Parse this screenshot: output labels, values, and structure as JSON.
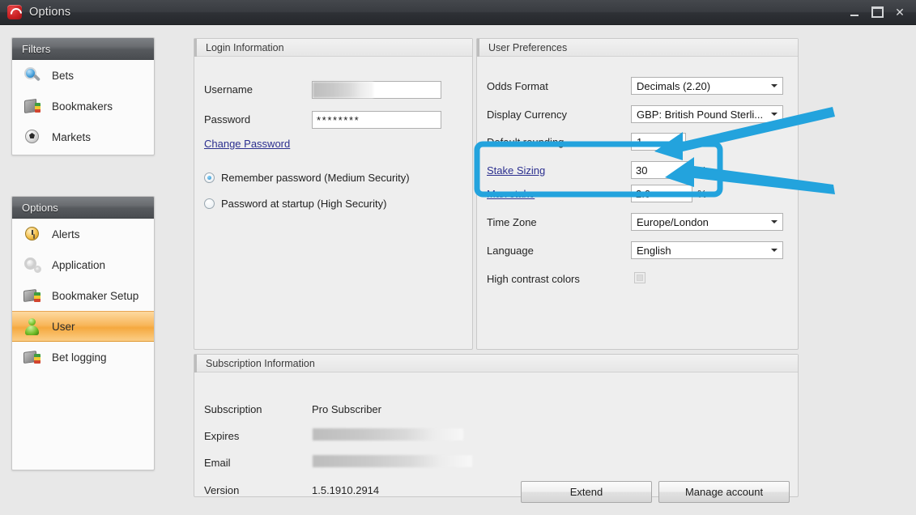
{
  "window": {
    "title": "Options",
    "app_icon": "app-logo-icon",
    "controls": [
      {
        "name": "minimize",
        "glyph": ""
      },
      {
        "name": "maximize",
        "glyph": ""
      },
      {
        "name": "close",
        "glyph": "✕"
      }
    ]
  },
  "sidebar": {
    "groups": [
      {
        "title": "Filters",
        "items": [
          {
            "label": "Bets",
            "icon": "magnifier-icon",
            "selected": false
          },
          {
            "label": "Bookmakers",
            "icon": "book-icon",
            "selected": false
          },
          {
            "label": "Markets",
            "icon": "football-icon",
            "selected": false
          }
        ]
      },
      {
        "title": "Options",
        "items": [
          {
            "label": "Alerts",
            "icon": "alarm-clock-icon",
            "selected": false
          },
          {
            "label": "Application",
            "icon": "gears-icon",
            "selected": false
          },
          {
            "label": "Bookmaker Setup",
            "icon": "bookmaker-setup-icon",
            "selected": false
          },
          {
            "label": "User",
            "icon": "user-icon",
            "selected": true
          },
          {
            "label": "Bet logging",
            "icon": "bet-logging-icon",
            "selected": false
          }
        ]
      }
    ]
  },
  "login": {
    "title": "Login Information",
    "username_label": "Username",
    "username_value": "",
    "password_label": "Password",
    "password_value": "********",
    "change_password_link": "Change Password",
    "radios": [
      {
        "label": "Remember password (Medium Security)",
        "selected": true
      },
      {
        "label": "Password at startup (High Security)",
        "selected": false
      }
    ]
  },
  "preferences": {
    "title": "User Preferences",
    "rows": [
      {
        "label": "Odds Format",
        "value": "Decimals (2.20)",
        "control": "combo",
        "unit": ""
      },
      {
        "label": "Display Currency",
        "value": "GBP: British Pound Sterli...",
        "control": "combo",
        "unit": ""
      },
      {
        "label": "Default rounding",
        "value": "1",
        "control": "combo-small",
        "unit": ""
      },
      {
        "label": "Stake Sizing",
        "value": "30",
        "control": "text",
        "unit": "%",
        "link": true
      },
      {
        "label": "Max stake",
        "value": "2.0",
        "control": "text",
        "unit": "%",
        "link": true
      },
      {
        "label": "Time Zone",
        "value": "Europe/London",
        "control": "combo",
        "unit": ""
      },
      {
        "label": "Language",
        "value": "English",
        "control": "combo",
        "unit": ""
      },
      {
        "label": "High contrast colors",
        "value": "",
        "control": "checkbox",
        "unit": "",
        "checked": false
      }
    ]
  },
  "subscription": {
    "title": "Subscription Information",
    "rows": [
      {
        "label": "Subscription",
        "value": "Pro Subscriber",
        "redacted": false
      },
      {
        "label": "Expires",
        "value": "",
        "redacted": true
      },
      {
        "label": "Email",
        "value": "",
        "redacted": true
      },
      {
        "label": "Version",
        "value": "1.5.1910.2914",
        "redacted": false
      }
    ],
    "buttons": [
      {
        "label": "Extend"
      },
      {
        "label": "Manage account"
      }
    ]
  },
  "annotations": {
    "highlight_color": "#23a3dd",
    "arrows": [
      {
        "name": "arrow-to-stake-sizing",
        "points_to": "Stake Sizing"
      },
      {
        "name": "arrow-to-max-stake",
        "points_to": "Max stake"
      }
    ],
    "highlight_box": {
      "name": "stake-fields-highlight"
    }
  },
  "colors": {
    "accent_blue": "#23a3dd",
    "selected_orange": "#f5a93f",
    "link_blue": "#2b2f8f",
    "titlebar": "#2e3136"
  }
}
